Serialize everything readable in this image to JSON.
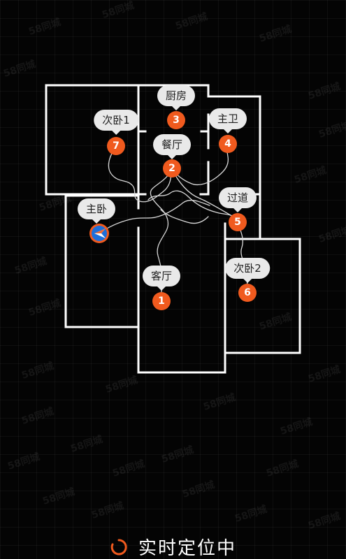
{
  "colors": {
    "background": "#000000",
    "wall": "#ffffff",
    "marker": "#f05a1e",
    "label_bg": "#e9e9e9",
    "label_text": "#1f1f1f",
    "path": "#d8d8d8",
    "pin_blue": "#1e6fd9"
  },
  "watermark": {
    "text": "58同城"
  },
  "rooms": [
    {
      "label": "次卧1",
      "marker": "7"
    },
    {
      "label": "厨房",
      "marker": "3"
    },
    {
      "label": "餐厅",
      "marker": "2"
    },
    {
      "label": "主卫",
      "marker": "4"
    },
    {
      "label": "过道",
      "marker": "5"
    },
    {
      "label": "客厅",
      "marker": "1"
    },
    {
      "label": "次卧2",
      "marker": "6"
    }
  ],
  "current_room": {
    "label": "主卧",
    "icon": "location-arrow-icon"
  },
  "status": {
    "icon": "loading-spinner-icon",
    "text": "实时定位中"
  }
}
